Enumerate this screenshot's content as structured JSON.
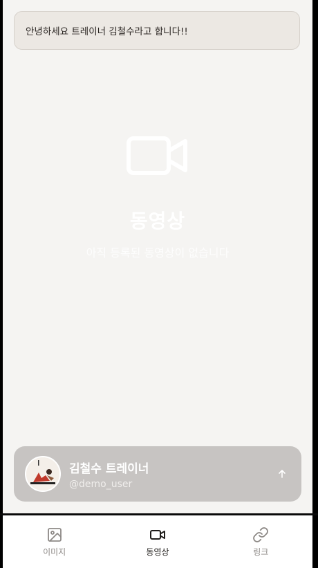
{
  "greeting": {
    "text": "안녕하세요 트레이너 김철수라고 합니다!!"
  },
  "empty_state": {
    "icon": "video-camera-icon",
    "title": "동영상",
    "subtitle": "아직 등록된 동영상이 없습니다"
  },
  "profile": {
    "name": "김철수 트레이너",
    "handle": "@demo_user",
    "action_icon": "arrow-up-icon"
  },
  "tabs": [
    {
      "label": "이미지",
      "icon": "image-icon",
      "active": false
    },
    {
      "label": "동영상",
      "icon": "video-icon",
      "active": true
    },
    {
      "label": "링크",
      "icon": "link-icon",
      "active": false
    }
  ],
  "colors": {
    "background": "#f5f4f2",
    "card": "#c7c4c2",
    "active_tab": "#1e1b19",
    "inactive_tab": "#8d8986"
  }
}
